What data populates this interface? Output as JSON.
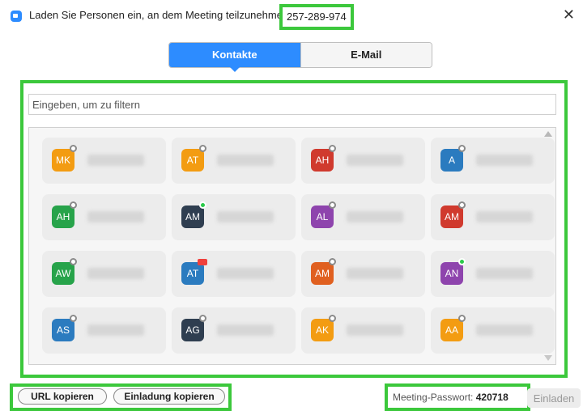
{
  "window": {
    "title": "Laden Sie Personen ein, an dem Meeting teilzunehmen",
    "meeting_id": "257-289-974",
    "close_icon": "close-icon"
  },
  "tabs": [
    {
      "label": "Kontakte",
      "active": true
    },
    {
      "label": "E-Mail",
      "active": false
    }
  ],
  "filter": {
    "placeholder": "Eingeben, um zu filtern",
    "value": ""
  },
  "contacts": [
    {
      "initials": "MK",
      "color": "#f39c12",
      "status": "offline",
      "name": "Manuel R"
    },
    {
      "initials": "AT",
      "color": "#f39c12",
      "status": "offline",
      "name": "Aaron Tru..."
    },
    {
      "initials": "AH",
      "color": "#d03a2e",
      "status": "offline",
      "name": "Aaron Hil..."
    },
    {
      "initials": "A",
      "color": "#2b7bbf",
      "status": "offline",
      "name": "adrian kus..."
    },
    {
      "initials": "AH",
      "color": "#27a34a",
      "status": "offline",
      "name": "adam hering"
    },
    {
      "initials": "AM",
      "color": "#2f3e50",
      "status": "online",
      "name": "Adam Mats..."
    },
    {
      "initials": "AL",
      "color": "#8e44ad",
      "status": "offline",
      "name": "Alexander..."
    },
    {
      "initials": "AM",
      "color": "#d03a2e",
      "status": "offline",
      "name": "Alexander..."
    },
    {
      "initials": "AW",
      "color": "#27a34a",
      "status": "offline",
      "name": "Alexander..."
    },
    {
      "initials": "AT",
      "color": "#2b7bbf",
      "status": "camera",
      "name": "Alexey Tu..."
    },
    {
      "initials": "AM",
      "color": "#e06020",
      "status": "offline",
      "name": "Alina Matuz"
    },
    {
      "initials": "AN",
      "color": "#8e44ad",
      "status": "online",
      "name": "Alina Nikul..."
    },
    {
      "initials": "AS",
      "color": "#2b7bbf",
      "status": "offline",
      "name": "Andre Schu..."
    },
    {
      "initials": "AG",
      "color": "#2f3e50",
      "status": "offline",
      "name": "Andrey Gu..."
    },
    {
      "initials": "AK",
      "color": "#f39c12",
      "status": "offline",
      "name": "Andrej Ko..."
    },
    {
      "initials": "AA",
      "color": "#f39c12",
      "status": "offline",
      "name": "Andreas Ab..."
    }
  ],
  "footer": {
    "copy_url_label": "URL kopieren",
    "copy_invite_label": "Einladung kopieren",
    "password_label": "Meeting-Passwort:",
    "password_value": "420718",
    "invite_label": "Einladen"
  },
  "colors": {
    "accent": "#2d8cff",
    "highlight": "#3cc83c"
  }
}
